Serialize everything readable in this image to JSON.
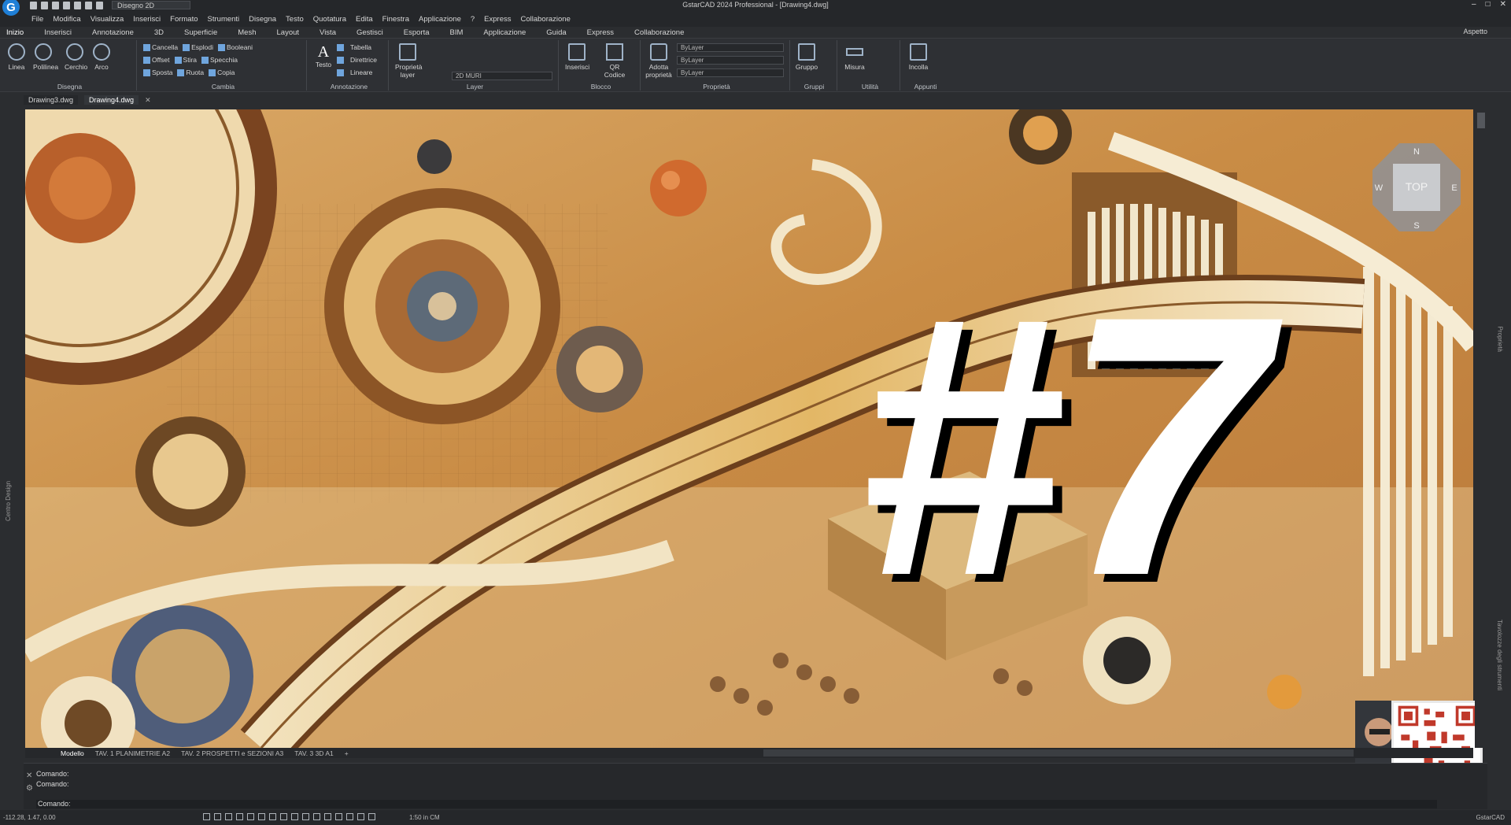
{
  "titlebar": {
    "title": "GstarCAD 2024 Professional - [Drawing4.dwg]",
    "workspace": "Disegno 2D",
    "app_icon": "G"
  },
  "menu": [
    "File",
    "Modifica",
    "Visualizza",
    "Inserisci",
    "Formato",
    "Strumenti",
    "Disegna",
    "Testo",
    "Quotatura",
    "Edita",
    "Finestra",
    "Applicazione",
    "?",
    "Express",
    "Collaborazione"
  ],
  "ribbon_tabs": [
    "Inizio",
    "Inserisci",
    "Annotazione",
    "3D",
    "Superficie",
    "Mesh",
    "Layout",
    "Vista",
    "Gestisci",
    "Esporta",
    "BIM",
    "Applicazione",
    "Guida",
    "Express",
    "Collaborazione"
  ],
  "ribbon_right": "Aspetto",
  "panels": {
    "disegna": {
      "label": "Disegna",
      "tools": [
        "Linea",
        "Polilinea",
        "Cerchio",
        "Arco"
      ]
    },
    "cambia": {
      "label": "Cambia",
      "rows": [
        [
          "Cancella",
          "Esplodi",
          "Booleani"
        ],
        [
          "Offset",
          "Stira",
          "Specchia"
        ],
        [
          "Sposta",
          "Ruota",
          "Copia"
        ]
      ]
    },
    "annotazione": {
      "label": "Annotazione",
      "tools": [
        "Testo"
      ],
      "rows": [
        "Tabella",
        "Direttrice",
        "Lineare"
      ]
    },
    "layer": {
      "label": "Layer",
      "tools": [
        "Proprietà layer"
      ],
      "combo": "2D MURI"
    },
    "blocco": {
      "label": "Blocco",
      "tools": [
        "Inserisci",
        "QR Codice"
      ]
    },
    "proprieta": {
      "label": "Proprietà",
      "tools": [
        "Adotta proprietà"
      ],
      "combos": [
        "ByLayer",
        "ByLayer",
        "ByLayer"
      ]
    },
    "gruppi": {
      "label": "Gruppi",
      "tools": [
        "Gruppo"
      ]
    },
    "utilita": {
      "label": "Utilità",
      "tools": [
        "Misura"
      ]
    },
    "appunti": {
      "label": "Appunti",
      "tools": [
        "Incolla"
      ]
    }
  },
  "doc_tabs": [
    "Drawing3.dwg",
    "Drawing4.dwg"
  ],
  "viewport": {
    "overlay_text": "#7",
    "viewcube": {
      "face": "TOP",
      "n": "N",
      "s": "S",
      "e": "E",
      "w": "W"
    }
  },
  "layout_tabs": [
    "Modello",
    "TAV. 1 PLANIMETRIE A2",
    "TAV. 2 PROSPETTI e SEZIONI A3",
    "TAV. 3 3D A1",
    "+"
  ],
  "side_labels": {
    "left": "Centro Design",
    "right_top": "Proprietà",
    "right_bottom": "Tavolozze degli strumenti"
  },
  "command": {
    "lines": [
      "Comando:",
      "Comando:"
    ],
    "input": "Comando:"
  },
  "status": {
    "coords": "-112.28, 1.47, 0.00",
    "scale": "1:50 in CM",
    "brand": "GstarCAD"
  },
  "colors": {
    "bg": "#2b2d30",
    "accent": "#1f7fd6",
    "art_base": "#c4894a"
  }
}
